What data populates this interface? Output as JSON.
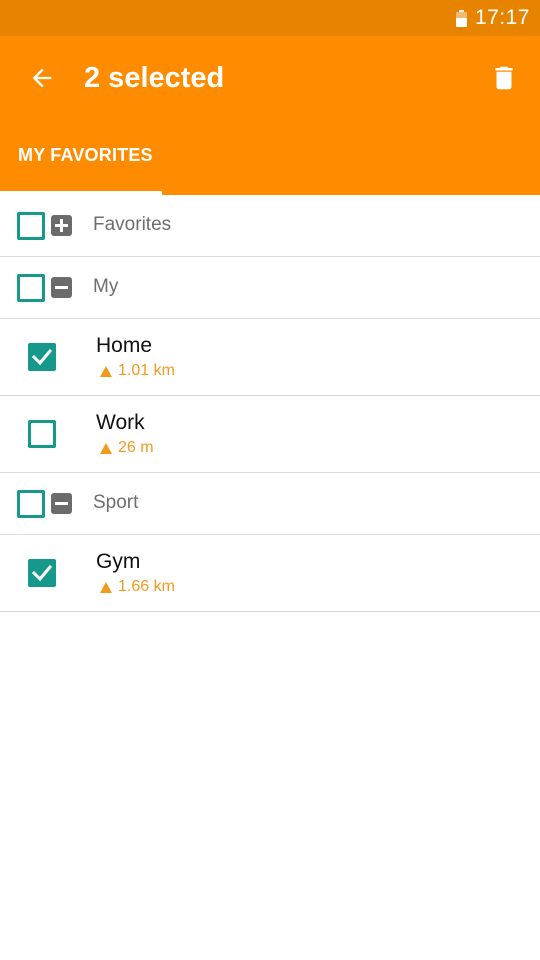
{
  "status_bar": {
    "time": "17:17",
    "battery_icon": "battery-icon"
  },
  "app_bar": {
    "title": "2 selected",
    "back_icon": "arrow-left-icon",
    "delete_icon": "trash-icon",
    "background_color": "#FF8C00"
  },
  "tabs": [
    {
      "label": "MY FAVORITES",
      "selected": true
    }
  ],
  "accent_color": "#16998A",
  "distance_color": "#F29A1E",
  "groups": [
    {
      "label": "Favorites",
      "checked": false,
      "expanded": false,
      "items": []
    },
    {
      "label": "My",
      "checked": false,
      "expanded": true,
      "items": [
        {
          "name": "Home",
          "distance": "1.01 km",
          "checked": true
        },
        {
          "name": "Work",
          "distance": "26 m",
          "checked": false
        }
      ]
    },
    {
      "label": "Sport",
      "checked": false,
      "expanded": true,
      "items": [
        {
          "name": "Gym",
          "distance": "1.66 km",
          "checked": true
        }
      ]
    }
  ]
}
